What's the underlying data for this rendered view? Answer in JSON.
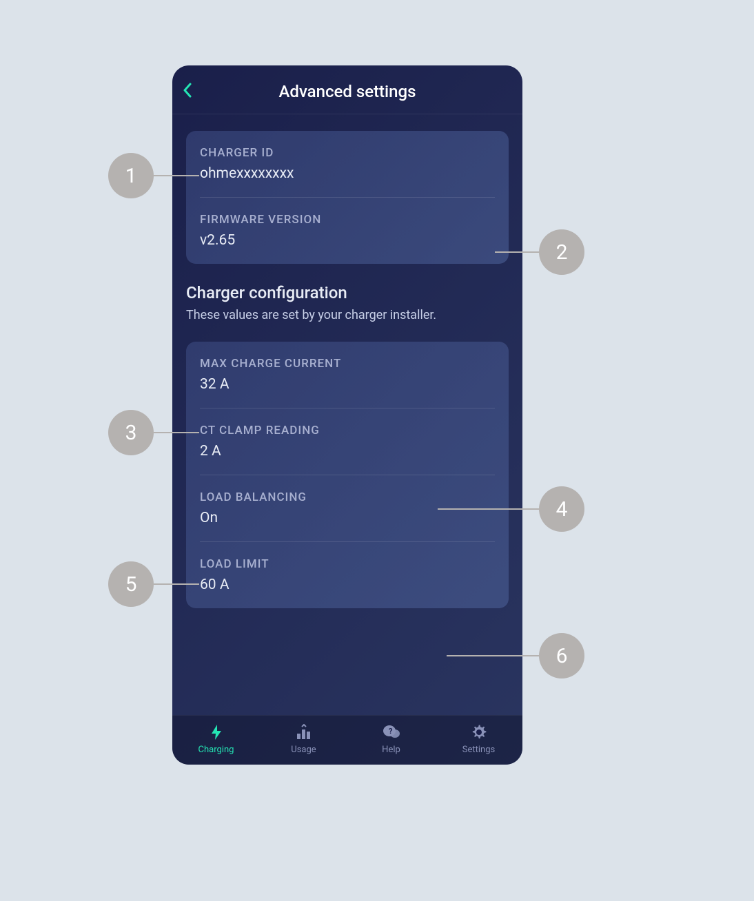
{
  "header": {
    "title": "Advanced settings"
  },
  "info_card": {
    "charger_id_label": "CHARGER ID",
    "charger_id_value": "ohmexxxxxxxx",
    "firmware_label": "FIRMWARE VERSION",
    "firmware_value": "v2.65"
  },
  "config_section": {
    "title": "Charger configuration",
    "subtitle": "These values are set by your charger installer."
  },
  "config_card": {
    "max_current_label": "MAX CHARGE CURRENT",
    "max_current_value": "32 A",
    "ct_clamp_label": "CT CLAMP READING",
    "ct_clamp_value": "2 A",
    "load_balancing_label": "LOAD BALANCING",
    "load_balancing_value": "On",
    "load_limit_label": "LOAD LIMIT",
    "load_limit_value": "60 A"
  },
  "tabs": {
    "charging": "Charging",
    "usage": "Usage",
    "help": "Help",
    "settings": "Settings"
  },
  "callouts": {
    "c1": "1",
    "c2": "2",
    "c3": "3",
    "c4": "4",
    "c5": "5",
    "c6": "6"
  }
}
